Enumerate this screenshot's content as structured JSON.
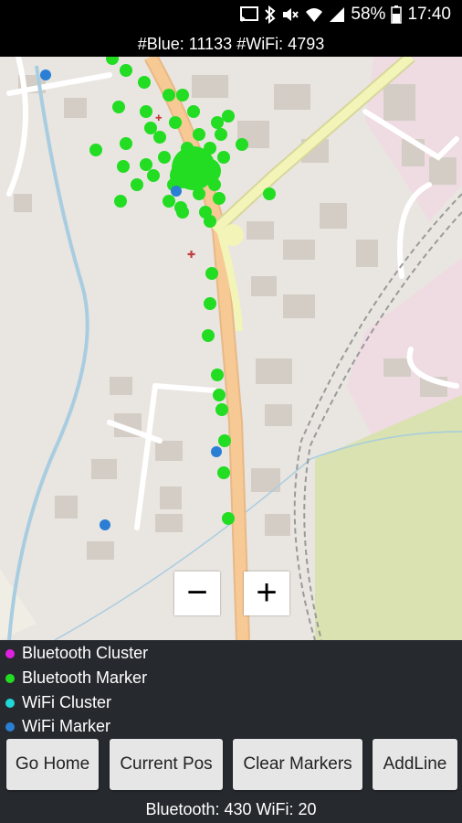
{
  "status_bar": {
    "battery": "58%",
    "time": "17:40",
    "icons": [
      "cast-icon",
      "bluetooth-icon",
      "mute-icon",
      "wifi-icon",
      "signal-icon",
      "battery-icon"
    ]
  },
  "header": {
    "counts": "#Blue: 11133 #WiFi: 4793"
  },
  "map": {
    "zoom_out_label": "−",
    "zoom_in_label": "+",
    "marker_colors": {
      "bluetooth": "#22dd22",
      "wifi": "#2a7fd4"
    }
  },
  "legend": {
    "items": [
      {
        "label": "Bluetooth Cluster",
        "color": "#e020e0"
      },
      {
        "label": "Bluetooth Marker",
        "color": "#22dd22"
      },
      {
        "label": "WiFi Cluster",
        "color": "#20d8d8"
      },
      {
        "label": "WiFi Marker",
        "color": "#2a7fd4"
      }
    ]
  },
  "buttons": {
    "go_home": "Go Home",
    "current_pos": "Current Pos",
    "clear_markers": "Clear Markers",
    "add_line": "AddLine"
  },
  "footer": {
    "stats": "Bluetooth: 430 WiFi: 20"
  }
}
